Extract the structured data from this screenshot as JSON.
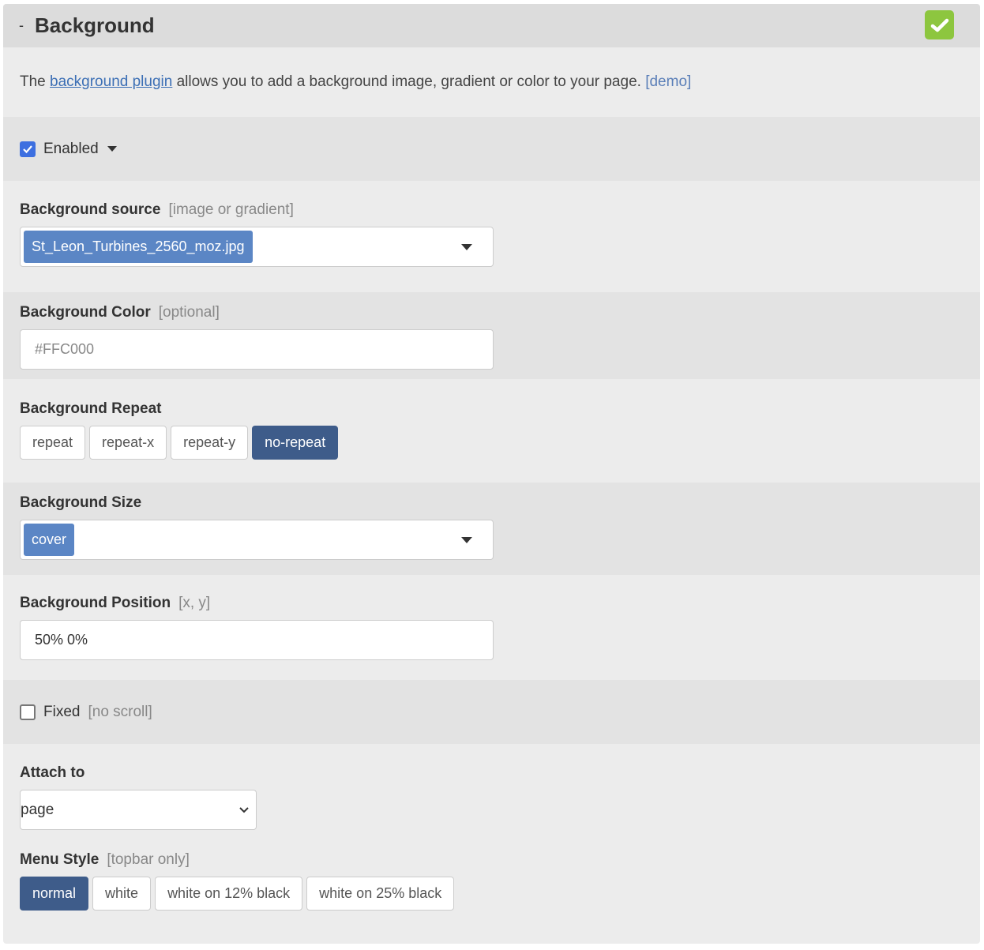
{
  "header": {
    "toggle": "-",
    "title": "Background",
    "status_icon": "check-icon",
    "status_color": "#8dc63f"
  },
  "intro": {
    "prefix": "The",
    "link": "background plugin",
    "middle": "allows you to add a background image, gradient or color to your page.",
    "demo": "[demo]"
  },
  "enabled": {
    "label": "Enabled",
    "checked": true
  },
  "source": {
    "label": "Background source",
    "hint": "[image or gradient]",
    "value": "St_Leon_Turbines_2560_moz.jpg"
  },
  "color": {
    "label": "Background Color",
    "hint": "[optional]",
    "placeholder": "#FFC000"
  },
  "repeat": {
    "label": "Background Repeat",
    "options": [
      "repeat",
      "repeat-x",
      "repeat-y",
      "no-repeat"
    ],
    "selected": "no-repeat"
  },
  "size": {
    "label": "Background Size",
    "value": "cover"
  },
  "position": {
    "label": "Background Position",
    "hint": "[x, y]",
    "value": "50% 0%"
  },
  "fixed": {
    "label": "Fixed",
    "hint": "[no scroll]",
    "checked": false
  },
  "attach": {
    "label": "Attach to",
    "value": "page"
  },
  "menu_style": {
    "label": "Menu Style",
    "hint": "[topbar only]",
    "options": [
      "normal",
      "white",
      "white on 12% black",
      "white on 25% black"
    ],
    "selected": "normal"
  },
  "colors": {
    "accent": "#3e5c8a",
    "tag": "#5b86c5",
    "checkbox": "#3d6fe0"
  }
}
